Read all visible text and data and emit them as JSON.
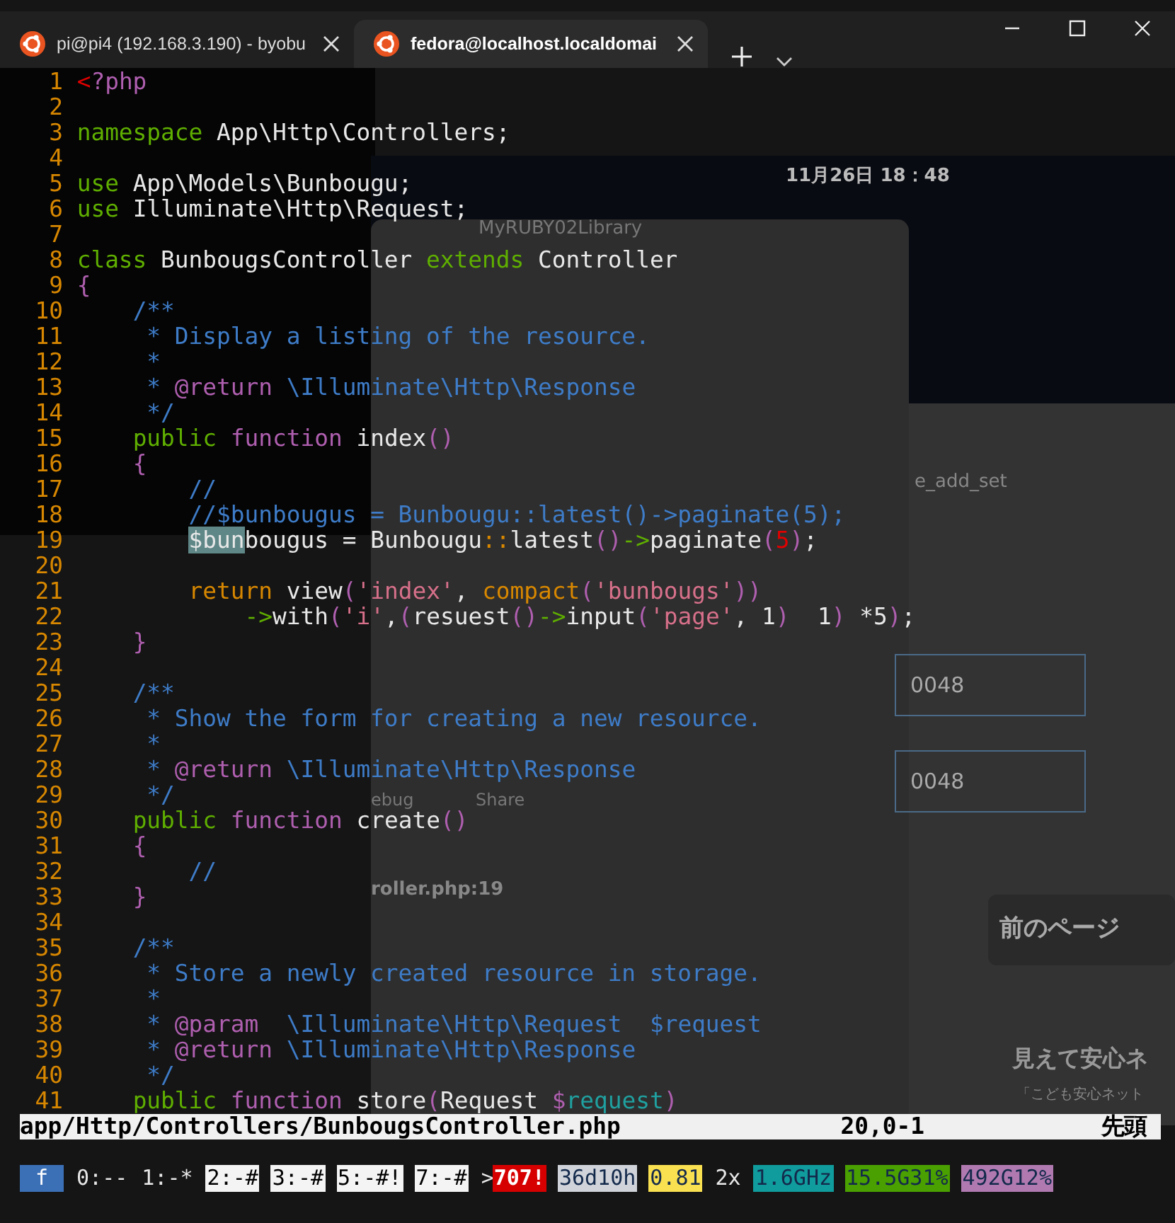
{
  "tabs": [
    {
      "title": "pi@pi4 (192.168.3.190) - byobu",
      "selected": false
    },
    {
      "title": "fedora@localhost.localdomai",
      "selected": true
    }
  ],
  "background": [
    {
      "kind": "clock",
      "text": "11月26日 18：48"
    },
    {
      "kind": "browser-tab",
      "text": "MyRUBY02Library"
    },
    {
      "kind": "page-label",
      "text": "e_add_set"
    },
    {
      "kind": "input",
      "text": "0048"
    },
    {
      "kind": "input",
      "text": "0048"
    },
    {
      "kind": "page-button",
      "text": "前のページ"
    },
    {
      "kind": "page-heading",
      "text": "見えて安心ネ"
    },
    {
      "kind": "page-note",
      "text": "「こども安心ネット"
    },
    {
      "kind": "debug-tab",
      "text": "ebug"
    },
    {
      "kind": "debug-tab",
      "text": "Share"
    },
    {
      "kind": "debug-file",
      "text": "roller.php:19"
    }
  ],
  "editor": {
    "lines": [
      {
        "number": "1",
        "tokens": [
          {
            "kind": "num",
            "text": "<"
          },
          {
            "kind": "fn",
            "text": "?php"
          }
        ]
      },
      {
        "number": "2"
      },
      {
        "number": "3",
        "tokens": [
          {
            "kind": "kw",
            "text": "namespace"
          },
          {
            "kind": "pl",
            "text": " App\\Http\\Controllers;"
          }
        ]
      },
      {
        "number": "4"
      },
      {
        "number": "5",
        "tokens": [
          {
            "kind": "kw",
            "text": "use"
          },
          {
            "kind": "pl",
            "text": " App\\Models\\Bunbougu;"
          }
        ]
      },
      {
        "number": "6",
        "tokens": [
          {
            "kind": "kw",
            "text": "use"
          },
          {
            "kind": "pl",
            "text": " Illuminate\\Http\\Request;"
          }
        ]
      },
      {
        "number": "7"
      },
      {
        "number": "8",
        "tokens": [
          {
            "kind": "kw",
            "text": "class"
          },
          {
            "kind": "pl",
            "text": " BunbougsController "
          },
          {
            "kind": "kw",
            "text": "extends"
          },
          {
            "kind": "pl",
            "text": " Controller"
          }
        ]
      },
      {
        "number": "9",
        "tokens": [
          {
            "kind": "fn",
            "text": "{"
          }
        ]
      },
      {
        "number": "10",
        "tokens": [
          {
            "kind": "cm",
            "text": "    /**"
          }
        ]
      },
      {
        "number": "11",
        "tokens": [
          {
            "kind": "cm",
            "text": "     * Display a listing of the resource."
          }
        ]
      },
      {
        "number": "12",
        "tokens": [
          {
            "kind": "cm",
            "text": "     *"
          }
        ]
      },
      {
        "number": "13",
        "tokens": [
          {
            "kind": "cm",
            "text": "     * "
          },
          {
            "kind": "fn",
            "text": "@return"
          },
          {
            "kind": "cm",
            "text": " \\Illuminate\\Http\\Response"
          }
        ]
      },
      {
        "number": "14",
        "tokens": [
          {
            "kind": "cm",
            "text": "     */"
          }
        ]
      },
      {
        "number": "15",
        "tokens": [
          {
            "kind": "kw",
            "text": "    public"
          },
          {
            "kind": "fn",
            "text": " function"
          },
          {
            "kind": "pl",
            "text": " index"
          },
          {
            "kind": "fn",
            "text": "()"
          }
        ]
      },
      {
        "number": "16",
        "tokens": [
          {
            "kind": "fn",
            "text": "    {"
          }
        ]
      },
      {
        "number": "17",
        "tokens": [
          {
            "kind": "cm",
            "text": "        //"
          }
        ]
      },
      {
        "number": "18",
        "tokens": [
          {
            "kind": "cm",
            "text": "        //$bunbougus = Bunbougu::latest()->paginate(5);"
          }
        ]
      },
      {
        "number": "19",
        "tokens": [
          {
            "kind": "hl",
            "text": "        $bun"
          },
          {
            "kind": "pl",
            "text": "bougus = Bunbougu"
          },
          {
            "kind": "op",
            "text": "::"
          },
          {
            "kind": "pl",
            "text": "latest"
          },
          {
            "kind": "fn",
            "text": "()"
          },
          {
            "kind": "kw",
            "text": "->"
          },
          {
            "kind": "pl",
            "text": "paginate"
          },
          {
            "kind": "fn",
            "text": "("
          },
          {
            "kind": "num",
            "text": "5"
          },
          {
            "kind": "fn",
            "text": ")"
          },
          {
            "kind": "pl",
            "text": ";"
          }
        ]
      },
      {
        "number": "20"
      },
      {
        "number": "21",
        "tokens": [
          {
            "kind": "op",
            "text": "        return"
          },
          {
            "kind": "pl",
            "text": " view"
          },
          {
            "kind": "fn",
            "text": "("
          },
          {
            "kind": "str",
            "text": "'index'"
          },
          {
            "kind": "pl",
            "text": ", "
          },
          {
            "kind": "op",
            "text": "compact"
          },
          {
            "kind": "fn",
            "text": "("
          },
          {
            "kind": "str",
            "text": "'bunbougs'"
          },
          {
            "kind": "fn",
            "text": "))"
          }
        ]
      },
      {
        "number": "22",
        "tokens": [
          {
            "kind": "kw",
            "text": "            ->"
          },
          {
            "kind": "pl",
            "text": "with"
          },
          {
            "kind": "fn",
            "text": "("
          },
          {
            "kind": "str",
            "text": "'i'"
          },
          {
            "kind": "pl",
            "text": ","
          },
          {
            "kind": "fn",
            "text": "("
          },
          {
            "kind": "pl",
            "text": "resuest"
          },
          {
            "kind": "fn",
            "text": "()"
          },
          {
            "kind": "kw",
            "text": "->"
          },
          {
            "kind": "pl",
            "text": "input"
          },
          {
            "kind": "fn",
            "text": "("
          },
          {
            "kind": "str",
            "text": "'page'"
          },
          {
            "kind": "pl",
            "text": ", 1"
          },
          {
            "kind": "fn",
            "text": ")"
          },
          {
            "kind": "pl",
            "text": "  1"
          },
          {
            "kind": "fn",
            "text": ")"
          },
          {
            "kind": "pl",
            "text": " *5"
          },
          {
            "kind": "fn",
            "text": ")"
          },
          {
            "kind": "pl",
            "text": ";"
          }
        ]
      },
      {
        "number": "23",
        "tokens": [
          {
            "kind": "fn",
            "text": "    }"
          }
        ]
      },
      {
        "number": "24"
      },
      {
        "number": "25",
        "tokens": [
          {
            "kind": "cm",
            "text": "    /**"
          }
        ]
      },
      {
        "number": "26",
        "tokens": [
          {
            "kind": "cm",
            "text": "     * Show the form for creating a new resource."
          }
        ]
      },
      {
        "number": "27",
        "tokens": [
          {
            "kind": "cm",
            "text": "     *"
          }
        ]
      },
      {
        "number": "28",
        "tokens": [
          {
            "kind": "cm",
            "text": "     * "
          },
          {
            "kind": "fn",
            "text": "@return"
          },
          {
            "kind": "cm",
            "text": " \\Illuminate\\Http\\Response"
          }
        ]
      },
      {
        "number": "29",
        "tokens": [
          {
            "kind": "cm",
            "text": "     */"
          }
        ]
      },
      {
        "number": "30",
        "tokens": [
          {
            "kind": "kw",
            "text": "    public"
          },
          {
            "kind": "fn",
            "text": " function"
          },
          {
            "kind": "pl",
            "text": " create"
          },
          {
            "kind": "fn",
            "text": "()"
          }
        ]
      },
      {
        "number": "31",
        "tokens": [
          {
            "kind": "fn",
            "text": "    {"
          }
        ]
      },
      {
        "number": "32",
        "tokens": [
          {
            "kind": "cm",
            "text": "        //"
          }
        ]
      },
      {
        "number": "33",
        "tokens": [
          {
            "kind": "fn",
            "text": "    }"
          }
        ]
      },
      {
        "number": "34"
      },
      {
        "number": "35",
        "tokens": [
          {
            "kind": "cm",
            "text": "    /**"
          }
        ]
      },
      {
        "number": "36",
        "tokens": [
          {
            "kind": "cm",
            "text": "     * Store a newly created resource in storage."
          }
        ]
      },
      {
        "number": "37",
        "tokens": [
          {
            "kind": "cm",
            "text": "     *"
          }
        ]
      },
      {
        "number": "38",
        "tokens": [
          {
            "kind": "cm",
            "text": "     * "
          },
          {
            "kind": "fn",
            "text": "@param"
          },
          {
            "kind": "cm",
            "text": "  \\Illuminate\\Http\\Request  $request"
          }
        ]
      },
      {
        "number": "39",
        "tokens": [
          {
            "kind": "cm",
            "text": "     * "
          },
          {
            "kind": "fn",
            "text": "@return"
          },
          {
            "kind": "cm",
            "text": " \\Illuminate\\Http\\Response"
          }
        ]
      },
      {
        "number": "40",
        "tokens": [
          {
            "kind": "cm",
            "text": "     */"
          }
        ]
      },
      {
        "number": "41",
        "tokens": [
          {
            "kind": "kw",
            "text": "    public"
          },
          {
            "kind": "fn",
            "text": " function"
          },
          {
            "kind": "pl",
            "text": " store"
          },
          {
            "kind": "fn",
            "text": "("
          },
          {
            "kind": "pl",
            "text": "Request "
          },
          {
            "kind": "fn",
            "text": "$"
          },
          {
            "kind": "var",
            "text": "request"
          },
          {
            "kind": "fn",
            "text": ")"
          }
        ]
      }
    ]
  },
  "status_line": {
    "file": "app/Http/Controllers/BunbougsController.php",
    "position": "20,0-1",
    "scroll": "先頭"
  },
  "byobu_bar": [
    {
      "kind": "logo",
      "text": "f",
      "color": "#3b6fb6"
    },
    {
      "kind": "plain",
      "text": "0:--"
    },
    {
      "kind": "plain",
      "text": "1:-*"
    },
    {
      "kind": "window",
      "text": "2:-#"
    },
    {
      "kind": "window",
      "text": "3:-#"
    },
    {
      "kind": "window",
      "text": "5:-#!"
    },
    {
      "kind": "window",
      "text": "7:-#"
    },
    {
      "kind": "plain",
      "text": ">"
    },
    {
      "kind": "alert",
      "text": "707!",
      "color": "#d70000"
    },
    {
      "kind": "chip",
      "text": "36d10h",
      "color": "#d0d4da"
    },
    {
      "kind": "chip",
      "text": "0.81",
      "color": "#f8e050"
    },
    {
      "kind": "plain",
      "text": "2x"
    },
    {
      "kind": "chip",
      "text": "1.6GHz",
      "color": "#109c9c"
    },
    {
      "kind": "chip",
      "text": "15.5G31%",
      "color": "#4aa000"
    },
    {
      "kind": "chip",
      "text": "492G12%",
      "color": "#b07ab0"
    }
  ]
}
